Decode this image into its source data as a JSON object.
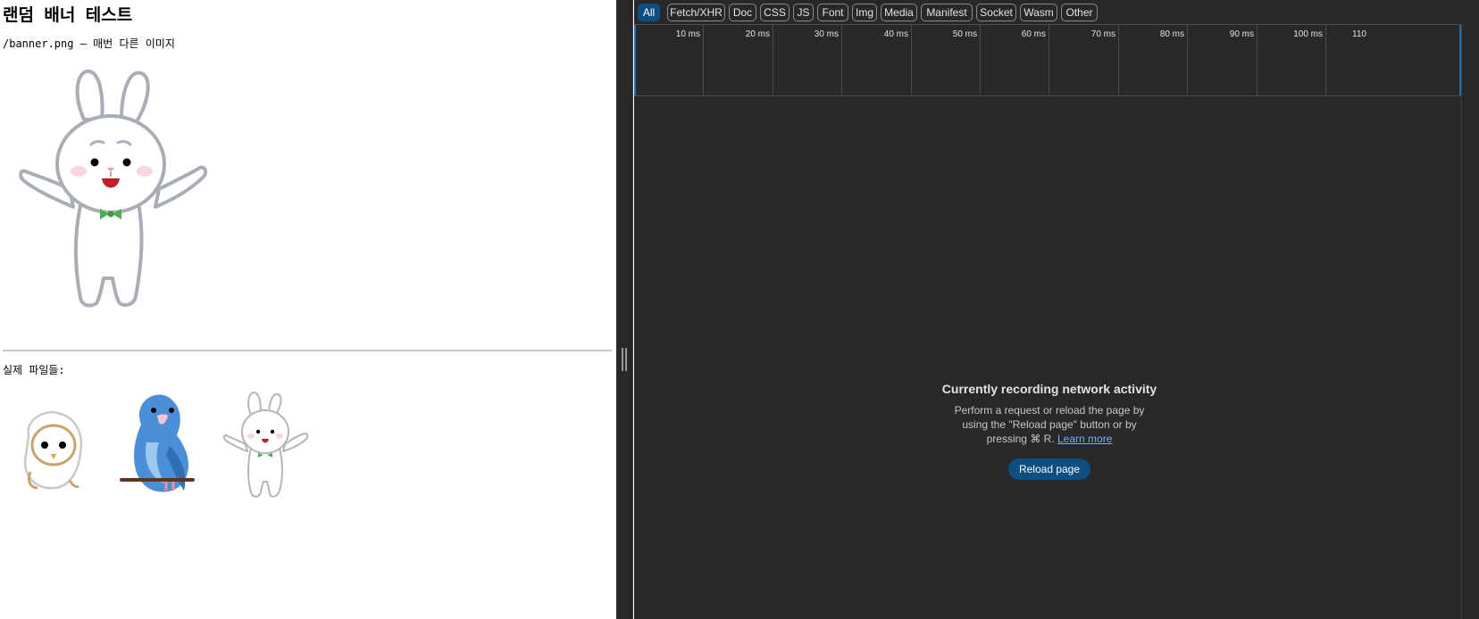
{
  "page": {
    "title": "랜덤 배너 테스트",
    "description": "/banner.png — 매번 다른 이미지",
    "files_label": "실제 파일들:"
  },
  "devtools": {
    "filters": [
      "All",
      "Fetch/XHR",
      "Doc",
      "CSS",
      "JS",
      "Font",
      "Img",
      "Media",
      "Manifest",
      "Socket",
      "Wasm",
      "Other"
    ],
    "active_filter": "All",
    "timeline_ticks": [
      "10 ms",
      "20 ms",
      "30 ms",
      "40 ms",
      "50 ms",
      "60 ms",
      "70 ms",
      "80 ms",
      "90 ms",
      "100 ms",
      "110"
    ],
    "empty_state": {
      "title": "Currently recording network activity",
      "line1": "Perform a request or reload the page by",
      "line2": "using the \"Reload page\" button or by",
      "line3": "pressing ⌘ R.",
      "learn_more": "Learn more",
      "reload_button": "Reload page"
    }
  },
  "colors": {
    "devtools_bg": "#282828",
    "accent": "#0c4f80",
    "link": "#7cacf8",
    "rabbit_bow": "#4caf50",
    "bird_blue": "#4a90d9"
  }
}
